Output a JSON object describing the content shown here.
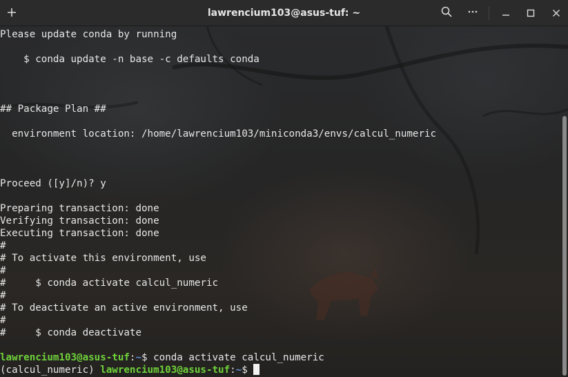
{
  "window": {
    "title": "lawrencium103@asus-tuf: ~"
  },
  "icons": {
    "new_tab": "plus-icon",
    "search": "search-icon",
    "menu": "ellipsis-icon",
    "minimize": "minimize-icon",
    "maximize": "maximize-icon",
    "close": "close-icon"
  },
  "colors": {
    "prompt_user": "#6fd23a",
    "prompt_path": "#5f8fd6",
    "text": "#e8e8e8"
  },
  "terminal": {
    "lines": [
      "Please update conda by running",
      "",
      "    $ conda update -n base -c defaults conda",
      "",
      "",
      "",
      "## Package Plan ##",
      "",
      "  environment location: /home/lawrencium103/miniconda3/envs/calcul_numeric",
      "",
      "",
      "",
      "Proceed ([y]/n)? y",
      "",
      "Preparing transaction: done",
      "Verifying transaction: done",
      "Executing transaction: done",
      "#",
      "# To activate this environment, use",
      "#",
      "#     $ conda activate calcul_numeric",
      "#",
      "# To deactivate an active environment, use",
      "#",
      "#     $ conda deactivate",
      ""
    ],
    "prompt1": {
      "user_host": "lawrencium103@asus-tuf",
      "colon": ":",
      "path": "~",
      "dollar": "$ ",
      "command": "conda activate calcul_numeric"
    },
    "prompt2": {
      "env": "(calcul_numeric) ",
      "user_host": "lawrencium103@asus-tuf",
      "colon": ":",
      "path": "~",
      "dollar": "$ "
    }
  }
}
